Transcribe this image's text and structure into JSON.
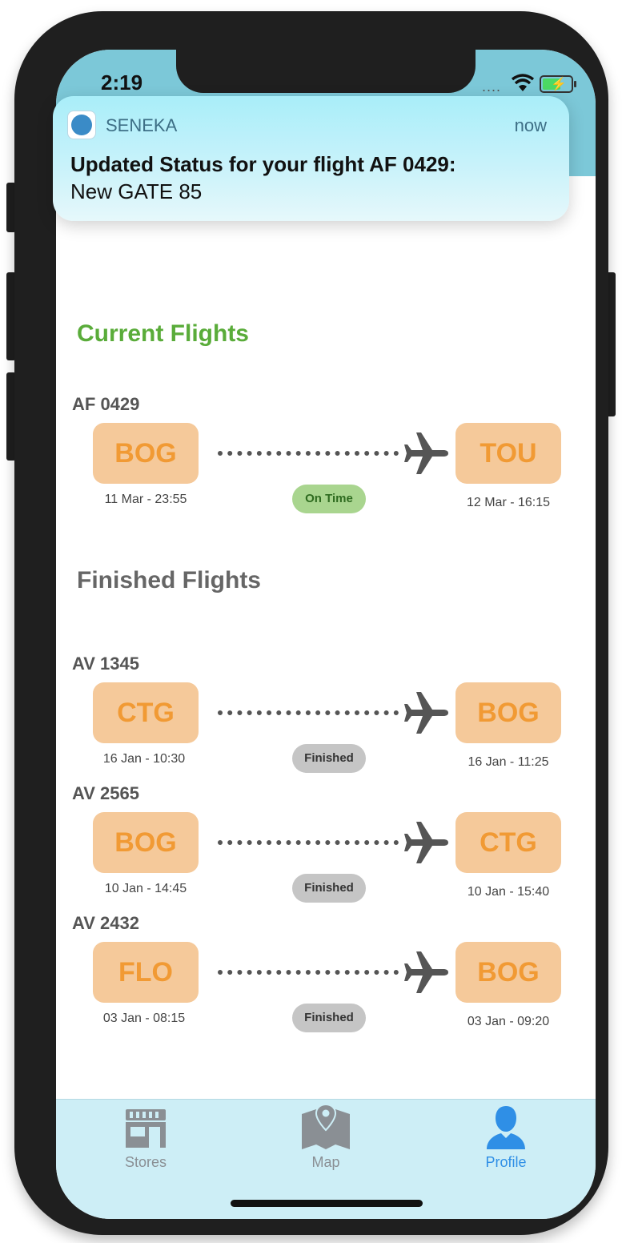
{
  "status_bar": {
    "time": "2:19",
    "signal": "....",
    "wifi_icon": "wifi-icon",
    "battery_icon": "battery-charging-icon"
  },
  "notification": {
    "app_name": "SENEKA",
    "time": "now",
    "title": "Updated Status for your flight AF 0429:",
    "body": "New GATE 85"
  },
  "current_section": {
    "title": "Current Flights",
    "color": "#5aac3a"
  },
  "finished_section": {
    "title": "Finished Flights",
    "color": "#666666"
  },
  "current_flights": [
    {
      "code": "AF 0429",
      "from": "BOG",
      "to": "TOU",
      "depart": "11 Mar - 23:55",
      "arrive": "12 Mar - 16:15",
      "status": "On Time"
    }
  ],
  "finished_flights": [
    {
      "code": "AV 1345",
      "from": "CTG",
      "to": "BOG",
      "depart": "16 Jan - 10:30",
      "arrive": "16 Jan - 11:25",
      "status": "Finished"
    },
    {
      "code": "AV 2565",
      "from": "BOG",
      "to": "CTG",
      "depart": "10 Jan - 14:45",
      "arrive": "10 Jan - 15:40",
      "status": "Finished"
    },
    {
      "code": "AV 2432",
      "from": "FLO",
      "to": "BOG",
      "depart": "03 Jan - 08:15",
      "arrive": "03 Jan - 09:20",
      "status": "Finished"
    }
  ],
  "tabbar": {
    "stores": "Stores",
    "map": "Map",
    "profile": "Profile",
    "active_color": "#2f8fe6",
    "inactive_color": "#8a8f94"
  }
}
